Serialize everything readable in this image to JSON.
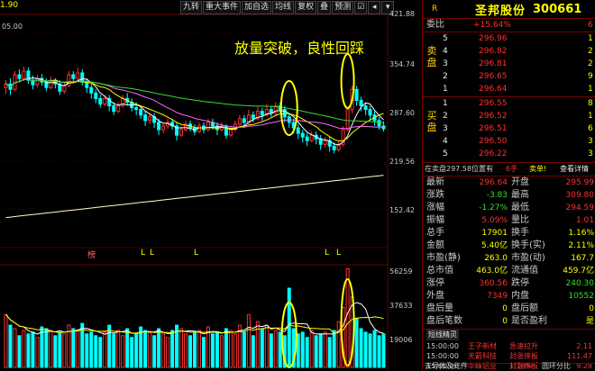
{
  "toolbar": {
    "top_left_price": "1.90",
    "buttons": [
      "九转",
      "重大事件",
      "加自选",
      "均线",
      "复权",
      "叠",
      "预测"
    ],
    "icon_buttons": [
      "check-icon",
      "triangle-icon",
      "triangle-down-icon"
    ]
  },
  "price_axis": [
    "421.88",
    "354.74",
    "287.60",
    "219.56",
    "152.42"
  ],
  "top_left_axis_value": "05.00",
  "volume_axis": [
    "56259",
    "37633",
    "19006"
  ],
  "annotation": "放量突破，良性回踩",
  "marker_label": "榜",
  "marker_l": "L",
  "stock": {
    "tag": "R",
    "name": "圣邦股份",
    "code": "300661",
    "wei_bi_label": "委比",
    "wei_bi_value": "+15.64%",
    "wei_bi_extra": "6",
    "sell_label": "卖盘",
    "buy_label": "买盘"
  },
  "sell_orders": [
    {
      "level": "5",
      "price": "296.96",
      "vol": "1"
    },
    {
      "level": "4",
      "price": "296.82",
      "vol": "2"
    },
    {
      "level": "3",
      "price": "296.81",
      "vol": "2"
    },
    {
      "level": "2",
      "price": "296.65",
      "vol": "9"
    },
    {
      "level": "1",
      "price": "296.64",
      "vol": "1"
    }
  ],
  "buy_orders": [
    {
      "level": "1",
      "price": "296.55",
      "vol": "8"
    },
    {
      "level": "2",
      "price": "296.52",
      "vol": "1"
    },
    {
      "level": "3",
      "price": "296.51",
      "vol": "6"
    },
    {
      "level": "4",
      "price": "296.50",
      "vol": "3"
    },
    {
      "level": "5",
      "price": "296.22",
      "vol": "3"
    }
  ],
  "trade_strip": {
    "a": "在卖盘297.58位置有",
    "b": "6手",
    "c": "卖单!",
    "d": "查看详情"
  },
  "quote": [
    {
      "l": "最新",
      "lv": "296.64",
      "r": "开盘",
      "rv": "295.99"
    },
    {
      "l": "涨跌",
      "lv": "-3.83",
      "r": "最高",
      "rv": "309.80"
    },
    {
      "l": "涨幅",
      "lv": "-1.27%",
      "r": "最低",
      "rv": "294.59"
    },
    {
      "l": "振幅",
      "lv": "5.09%",
      "r": "量比",
      "rv": "1.01"
    },
    {
      "l": "总手",
      "lv": "17901",
      "r": "换手",
      "rv": "1.16%"
    },
    {
      "l": "金额",
      "lv": "5.40亿",
      "r": "换手(实)",
      "rv": "2.11%"
    },
    {
      "l": "市盈(静)",
      "lv": "263.0",
      "r": "市盈(动)",
      "rv": "167.7"
    },
    {
      "l": "总市值",
      "lv": "463.0亿",
      "r": "流通值",
      "rv": "459.7亿"
    },
    {
      "l": "涨停",
      "lv": "360.56",
      "r": "跌停",
      "rv": "240.30"
    },
    {
      "l": "外盘",
      "lv": "7349",
      "r": "内盘",
      "rv": "10552"
    },
    {
      "l": "盘后量",
      "lv": "0",
      "r": "盘后额",
      "rv": "0"
    },
    {
      "l": "盘后笔数",
      "lv": "0",
      "r": "是否盈利",
      "rv": "是"
    }
  ],
  "short_line": {
    "title": "短线精灵",
    "rows": [
      {
        "t": "15:00:00",
        "n": "王子新材",
        "e": "急速拉升",
        "v": "2.11"
      },
      {
        "t": "15:00:00",
        "n": "天箭科技",
        "e": "封涨停板",
        "v": "111.47"
      },
      {
        "t": "15:00:00",
        "n": "华峰铝业",
        "e": "封涨停板",
        "v": "9.28"
      }
    ]
  },
  "bottom_strip": {
    "left": "去导体及元件",
    "mid": "1.16%",
    "right": "圆环分比"
  },
  "colors": {
    "up": "#ff3030",
    "down": "#00ffff",
    "ma5": "#ffffff",
    "ma10": "#ffff00",
    "ma20": "#ff66ff",
    "ma60": "#33dd33",
    "annot": "#ffff00"
  },
  "chart_data": {
    "type": "candlestick",
    "price_range": [
      152.42,
      421.88
    ],
    "volume_range": [
      0,
      56259
    ],
    "candles": [
      [
        342,
        346,
        335,
        350
      ],
      [
        346,
        340,
        334,
        352
      ],
      [
        340,
        356,
        338,
        360
      ],
      [
        356,
        352,
        348,
        362
      ],
      [
        352,
        360,
        349,
        365
      ],
      [
        360,
        350,
        346,
        364
      ],
      [
        350,
        345,
        340,
        355
      ],
      [
        345,
        352,
        342,
        356
      ],
      [
        352,
        348,
        344,
        357
      ],
      [
        348,
        342,
        338,
        352
      ],
      [
        342,
        350,
        340,
        354
      ],
      [
        350,
        346,
        341,
        352
      ],
      [
        346,
        338,
        334,
        350
      ],
      [
        338,
        344,
        335,
        348
      ],
      [
        344,
        356,
        342,
        360
      ],
      [
        356,
        352,
        348,
        360
      ],
      [
        352,
        358,
        350,
        364
      ],
      [
        358,
        348,
        344,
        362
      ],
      [
        348,
        342,
        336,
        352
      ],
      [
        342,
        336,
        330,
        346
      ],
      [
        336,
        330,
        325,
        340
      ],
      [
        330,
        324,
        320,
        334
      ],
      [
        324,
        330,
        322,
        334
      ],
      [
        330,
        322,
        316,
        334
      ],
      [
        322,
        316,
        312,
        326
      ],
      [
        316,
        322,
        314,
        326
      ],
      [
        322,
        330,
        320,
        334
      ],
      [
        330,
        326,
        322,
        336
      ],
      [
        326,
        320,
        316,
        330
      ],
      [
        320,
        318,
        312,
        326
      ],
      [
        318,
        312,
        308,
        322
      ],
      [
        312,
        306,
        300,
        316
      ],
      [
        306,
        310,
        302,
        314
      ],
      [
        310,
        304,
        298,
        314
      ],
      [
        304,
        296,
        290,
        308
      ],
      [
        296,
        300,
        292,
        304
      ],
      [
        300,
        304,
        297,
        308
      ],
      [
        304,
        300,
        296,
        308
      ],
      [
        300,
        290,
        284,
        304
      ],
      [
        290,
        296,
        288,
        300
      ],
      [
        296,
        302,
        294,
        306
      ],
      [
        302,
        298,
        294,
        306
      ],
      [
        298,
        294,
        290,
        302
      ],
      [
        294,
        300,
        292,
        304
      ],
      [
        300,
        296,
        292,
        304
      ],
      [
        296,
        304,
        294,
        308
      ],
      [
        304,
        300,
        296,
        308
      ],
      [
        300,
        296,
        290,
        304
      ],
      [
        296,
        300,
        294,
        304
      ],
      [
        300,
        290,
        286,
        302
      ],
      [
        290,
        296,
        288,
        300
      ],
      [
        296,
        302,
        294,
        306
      ],
      [
        302,
        308,
        300,
        312
      ],
      [
        308,
        304,
        300,
        312
      ],
      [
        304,
        312,
        302,
        318
      ],
      [
        312,
        308,
        304,
        316
      ],
      [
        308,
        316,
        306,
        322
      ],
      [
        316,
        312,
        306,
        320
      ],
      [
        312,
        318,
        310,
        324
      ],
      [
        318,
        314,
        310,
        322
      ],
      [
        314,
        322,
        312,
        326
      ],
      [
        322,
        318,
        314,
        326
      ],
      [
        318,
        310,
        304,
        322
      ],
      [
        310,
        304,
        298,
        314
      ],
      [
        304,
        298,
        292,
        308
      ],
      [
        298,
        292,
        286,
        302
      ],
      [
        292,
        288,
        282,
        296
      ],
      [
        288,
        284,
        278,
        292
      ],
      [
        284,
        290,
        282,
        294
      ],
      [
        290,
        286,
        280,
        294
      ],
      [
        286,
        280,
        274,
        290
      ],
      [
        280,
        284,
        276,
        288
      ],
      [
        284,
        278,
        272,
        288
      ],
      [
        278,
        274,
        270,
        282
      ],
      [
        274,
        280,
        272,
        284
      ],
      [
        280,
        296,
        278,
        300
      ],
      [
        296,
        318,
        294,
        320
      ],
      [
        318,
        340,
        314,
        344
      ],
      [
        340,
        328,
        322,
        344
      ],
      [
        328,
        322,
        316,
        332
      ],
      [
        322,
        318,
        312,
        326
      ],
      [
        318,
        312,
        306,
        322
      ],
      [
        312,
        306,
        300,
        316
      ],
      [
        306,
        300,
        296,
        310
      ],
      [
        300,
        297,
        294,
        305
      ]
    ],
    "volumes": [
      30000,
      24000,
      22000,
      18000,
      21000,
      19000,
      20000,
      17000,
      23000,
      22000,
      21000,
      18000,
      20000,
      19000,
      24000,
      22000,
      21000,
      25000,
      19000,
      20000,
      18000,
      17000,
      20000,
      24000,
      19000,
      21000,
      18000,
      22000,
      17000,
      19000,
      23000,
      21000,
      20000,
      18000,
      22000,
      19000,
      17000,
      21000,
      24000,
      22000,
      19000,
      18000,
      20000,
      21000,
      17000,
      23000,
      19000,
      20000,
      18000,
      22000,
      21000,
      19000,
      24000,
      20000,
      30000,
      18000,
      26000,
      22000,
      24000,
      19000,
      21000,
      20000,
      18000,
      45000,
      22000,
      19000,
      20000,
      17000,
      21000,
      18000,
      19000,
      20000,
      17000,
      21000,
      26000,
      34000,
      56000,
      40000,
      28000,
      22000,
      20000,
      19000,
      21000,
      18000,
      19006
    ]
  }
}
